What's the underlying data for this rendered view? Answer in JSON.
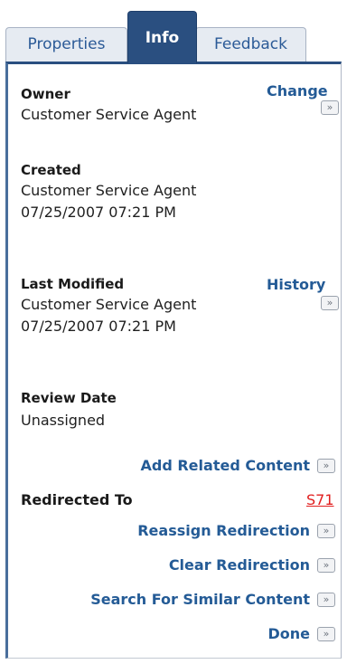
{
  "tabs": {
    "properties": "Properties",
    "info": "Info",
    "feedback": "Feedback"
  },
  "owner": {
    "label": "Owner",
    "value": "Customer Service Agent",
    "link": "Change"
  },
  "created": {
    "label": "Created",
    "value": "Customer Service Agent 07/25/2007 07:21 PM"
  },
  "last_modified": {
    "label": "Last Modified",
    "value": "Customer Service Agent 07/25/2007 07:21 PM",
    "link": "History"
  },
  "review_date": {
    "label": "Review Date",
    "value": "Unassigned"
  },
  "actions": {
    "add_related": "Add Related Content",
    "redirected_label": "Redirected To",
    "redirected_value": "S71",
    "reassign": "Reassign Redirection",
    "clear": "Clear Redirection",
    "search_similar": "Search For Similar Content",
    "done": "Done"
  },
  "go_glyph": "»",
  "colors": {
    "accent": "#2a4f80",
    "link": "#245b96",
    "redirect": "#e11f1f"
  }
}
